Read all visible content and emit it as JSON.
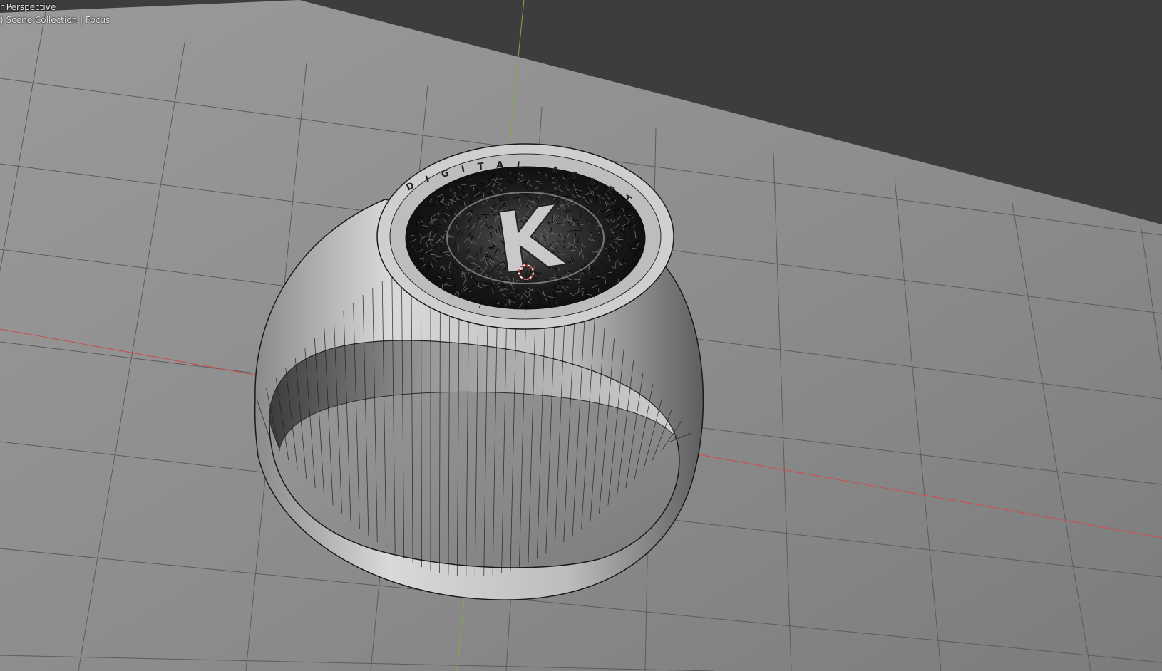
{
  "viewport": {
    "view_name": "r Perspective",
    "collection_prefix": ") Scene Collection",
    "separator": "|",
    "active_object": "Focus"
  },
  "model": {
    "engraving_letter": "K",
    "engraving_text": "DIGITAL ASSET"
  },
  "colors": {
    "background": "#3d3d3d",
    "ground_plane": "#8c8c8c",
    "grid_line": "#5b5b5b",
    "x_axis": "#d24b4b",
    "y_axis": "#7fae3c",
    "wire": "#111111",
    "cursor": "#d93a3a"
  },
  "icons": [
    "3d-cursor-icon"
  ]
}
